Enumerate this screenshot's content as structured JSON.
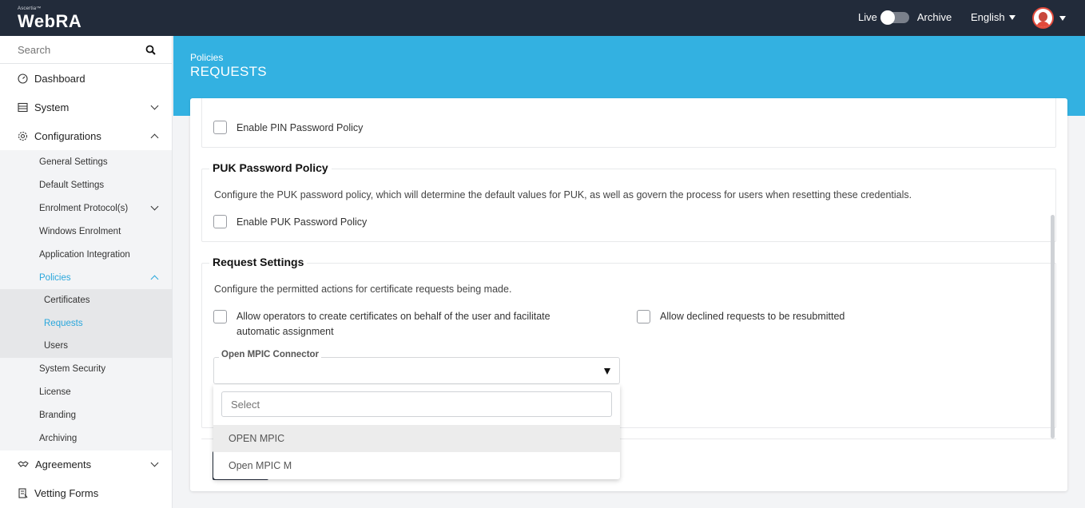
{
  "brand": {
    "small": "Ascertia™",
    "name": "WebRA"
  },
  "header": {
    "live_label": "Live",
    "archive_label": "Archive",
    "language": "English"
  },
  "sidebar": {
    "search_placeholder": "Search",
    "dashboard": "Dashboard",
    "system": "System",
    "configurations": "Configurations",
    "config_items": [
      "General Settings",
      "Default Settings",
      "Enrolment Protocol(s)",
      "Windows Enrolment",
      "Application Integration",
      "Policies"
    ],
    "policy_items": [
      "Certificates",
      "Requests",
      "Users"
    ],
    "config_items_after": [
      "System Security",
      "License",
      "Branding",
      "Archiving"
    ],
    "agreements": "Agreements",
    "vetting_forms": "Vetting Forms"
  },
  "page": {
    "breadcrumb": "Policies",
    "title": "REQUESTS"
  },
  "pin": {
    "checkbox_label": "Enable PIN Password Policy"
  },
  "puk": {
    "title": "PUK Password Policy",
    "description": "Configure the PUK password policy, which will determine the default values for PUK, as well as govern the process for users when resetting these credentials.",
    "checkbox_label": "Enable PUK Password Policy"
  },
  "request_settings": {
    "title": "Request Settings",
    "description": "Configure the permitted actions for certificate requests being made.",
    "allow_operators_line1": "Allow operators to create certificates on behalf of the user and facilitate",
    "allow_operators_line2": "automatic assignment",
    "allow_declined": "Allow declined requests to be resubmitted",
    "connector_label": "Open MPIC Connector",
    "connector_value": ""
  },
  "dropdown": {
    "search_placeholder": "Select",
    "options": [
      "OPEN MPIC",
      "Open MPIC M"
    ]
  },
  "colors": {
    "topbar": "#222b3a",
    "accent": "#33b1e1",
    "link_active": "#2aa7dc"
  }
}
